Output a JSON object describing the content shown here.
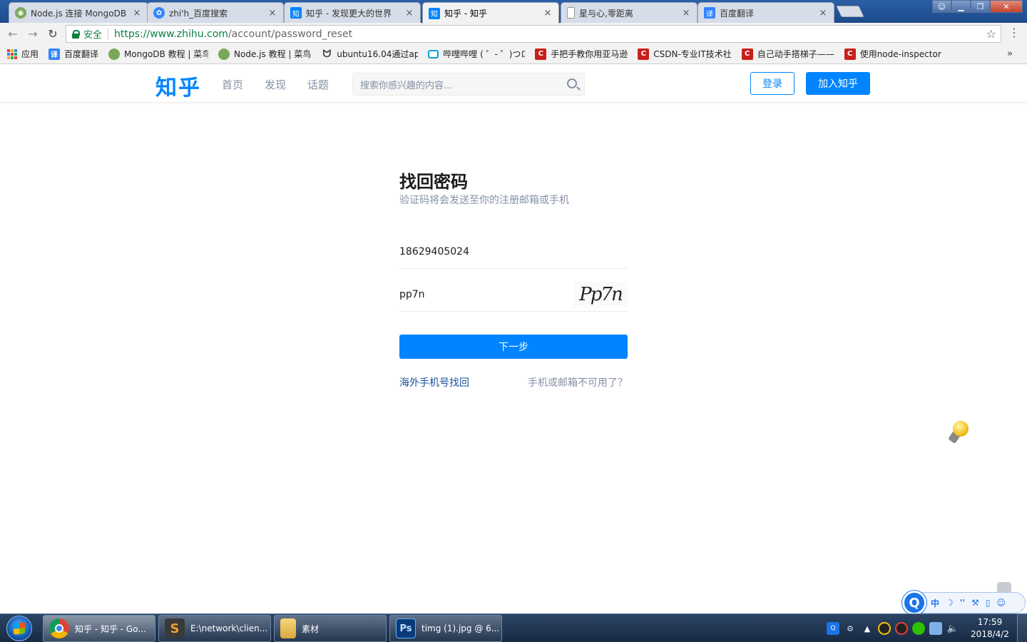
{
  "browser": {
    "tabs": [
      {
        "title": "Node.js 连接 MongoDB",
        "icon": "runoob-icon",
        "color": "#7aa85a"
      },
      {
        "title": "zhi'h_百度搜索",
        "icon": "baidu-paw-icon",
        "color": "#3385ff"
      },
      {
        "title": "知乎 - 发现更大的世界",
        "icon": "zhihu-icon",
        "color": "#0084ff"
      },
      {
        "title": "知乎 - 知乎",
        "icon": "zhihu-icon",
        "color": "#0084ff"
      },
      {
        "title": "星与心,零距离",
        "icon": "page-icon",
        "color": "#999999"
      },
      {
        "title": "百度翻译",
        "icon": "baidu-translate-icon",
        "color": "#3385ff"
      }
    ],
    "tab_close_glyph": "×",
    "active_tab_index": 3,
    "address": {
      "secure_label": "安全",
      "scheme": "https://",
      "host": "www.zhihu.com",
      "path": "/account/password_reset"
    },
    "bookmarks": [
      {
        "label": "应用",
        "icon": "apps-grid-icon"
      },
      {
        "label": "百度翻译",
        "icon": "baidu-translate-icon",
        "glyph": "译",
        "color": "#3385ff"
      },
      {
        "label": "MongoDB 教程 | 菜鸟",
        "icon": "runoob-icon",
        "glyph": "",
        "color": "#7aa85a"
      },
      {
        "label": "Node.js 教程 | 菜鸟",
        "icon": "runoob-icon",
        "glyph": "",
        "color": "#7aa85a"
      },
      {
        "label": "ubuntu16.04通过ap",
        "icon": "ubuntu-icon",
        "glyph": "",
        "color": "#666666"
      },
      {
        "label": "哔哩哔哩 ( ゜- ゜)つロ",
        "icon": "bilibili-icon",
        "glyph": "",
        "color": "#00a1d6"
      },
      {
        "label": "手把手教你用亚马逊",
        "icon": "csdn-icon",
        "glyph": "C",
        "color": "#c9201a"
      },
      {
        "label": "CSDN-专业IT技术社",
        "icon": "csdn-icon",
        "glyph": "C",
        "color": "#c9201a"
      },
      {
        "label": "自己动手搭梯子——",
        "icon": "csdn-icon",
        "glyph": "C",
        "color": "#c9201a"
      },
      {
        "label": "使用node-inspector",
        "icon": "csdn-icon",
        "glyph": "C",
        "color": "#c9201a"
      }
    ],
    "bookmarks_more": "»"
  },
  "zhihu": {
    "logo": "知乎",
    "nav": [
      "首页",
      "发现",
      "话题"
    ],
    "search_placeholder": "搜索你感兴趣的内容...",
    "login_label": "登录",
    "join_label": "加入知乎",
    "brand_color": "#0084ff"
  },
  "reset": {
    "title": "找回密码",
    "subtitle": "验证码将会发送至你的注册邮箱或手机",
    "phone_value": "18629405024",
    "captcha_value": "pp7n",
    "captcha_image_text": "Pp7n",
    "next_label": "下一步",
    "overseas_link": "海外手机号找回",
    "unavailable_link": "手机或邮箱不可用了？"
  },
  "ime": {
    "logo": "Q",
    "items": [
      "中",
      "☽",
      "''",
      "⚒",
      "▯",
      "☺"
    ]
  },
  "taskbar": {
    "tasks": [
      {
        "label": "知乎 - 知乎 - Go...",
        "icon": "chrome-icon",
        "color": "#4285f4"
      },
      {
        "label": "E:\\network\\clien...",
        "icon": "sublime-icon",
        "color": "#f29c30"
      },
      {
        "label": "素材",
        "icon": "folder-icon",
        "color": "#e8c35a"
      },
      {
        "label": "timg (1).jpg @ 6...",
        "icon": "photoshop-icon",
        "color": "#0a3a78"
      }
    ],
    "active_task_index": 0,
    "clock_time": "17:59",
    "clock_date": "2018/4/2"
  }
}
